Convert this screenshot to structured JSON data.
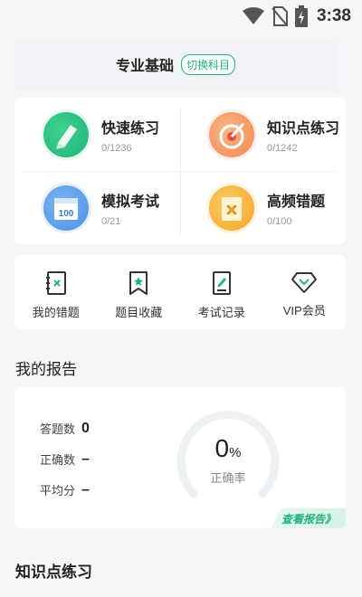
{
  "status": {
    "time": "3:38"
  },
  "subject": {
    "name": "专业基础",
    "switch_label": "切换科目"
  },
  "practice": [
    {
      "title": "快速练习",
      "count": "0/1236",
      "icon": "pencil-icon"
    },
    {
      "title": "知识点练习",
      "count": "0/1242",
      "icon": "target-icon"
    },
    {
      "title": "模拟考试",
      "count": "0/21",
      "icon": "calendar-100-icon"
    },
    {
      "title": "高频错题",
      "count": "0/100",
      "icon": "error-book-icon"
    }
  ],
  "tools": [
    {
      "label": "我的错题",
      "icon": "wrong-notebook-icon"
    },
    {
      "label": "题目收藏",
      "icon": "bookmark-star-icon"
    },
    {
      "label": "考试记录",
      "icon": "record-edit-icon"
    },
    {
      "label": "VIP会员",
      "icon": "vip-diamond-icon"
    }
  ],
  "report": {
    "title": "我的报告",
    "answered_label": "答题数",
    "answered_value": "0",
    "correct_label": "正确数",
    "correct_value": "–",
    "avg_label": "平均分",
    "avg_value": "–",
    "rate_value": "0",
    "rate_unit": "%",
    "rate_label": "正确率",
    "view_link": "查看报告》"
  },
  "knowledge_section": {
    "title": "知识点练习"
  },
  "colors": {
    "accent": "#1fb47a",
    "orange": "#f08a4b",
    "blue": "#4a8fe0",
    "yellow": "#f5a623"
  }
}
